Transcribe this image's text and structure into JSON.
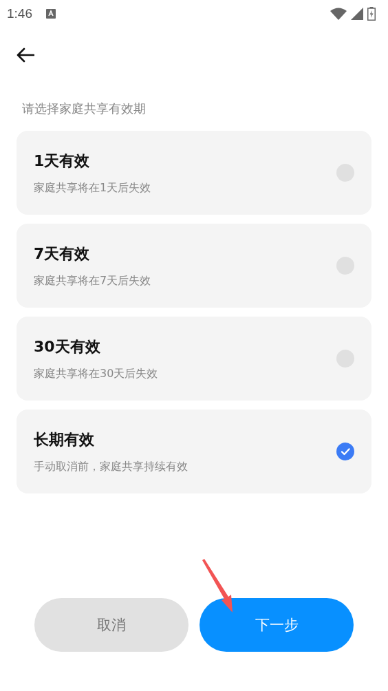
{
  "status_bar": {
    "time": "1:46"
  },
  "prompt": "请选择家庭共享有效期",
  "options": [
    {
      "title": "1天有效",
      "description": "家庭共享将在1天后失效",
      "selected": false
    },
    {
      "title": "7天有效",
      "description": "家庭共享将在7天后失效",
      "selected": false
    },
    {
      "title": "30天有效",
      "description": "家庭共享将在30天后失效",
      "selected": false
    },
    {
      "title": "长期有效",
      "description": "手动取消前，家庭共享持续有效",
      "selected": true
    }
  ],
  "buttons": [
    {
      "label": "取消",
      "kind": "secondary"
    },
    {
      "label": "下一步",
      "kind": "primary"
    }
  ]
}
